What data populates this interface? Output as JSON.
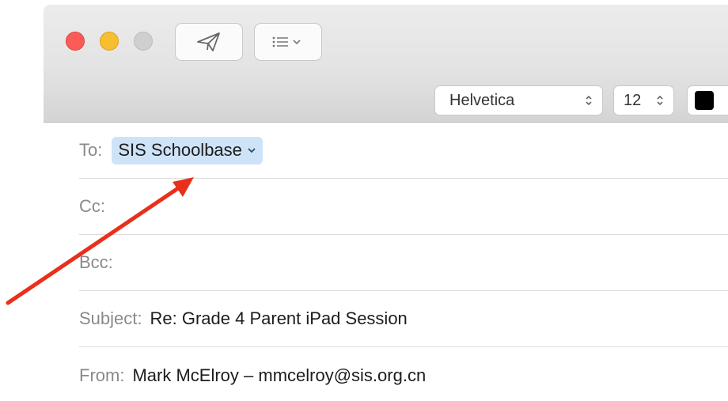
{
  "toolbar": {
    "traffic_lights": [
      "close",
      "minimize",
      "zoom"
    ],
    "send_icon": "paper-plane-icon",
    "list_icon": "list-chevron-icon",
    "font_family": "Helvetica",
    "font_size": "12",
    "text_color": "#000000"
  },
  "header": {
    "to": {
      "label": "To:",
      "recipient": "SIS Schoolbase"
    },
    "cc": {
      "label": "Cc:",
      "value": ""
    },
    "bcc": {
      "label": "Bcc:",
      "value": ""
    },
    "subject": {
      "label": "Subject:",
      "value": "Re: Grade 4 Parent iPad Session"
    },
    "from": {
      "label": "From:",
      "value": "Mark McElroy – mmcelroy@sis.org.cn"
    }
  },
  "annotation": {
    "arrow_color": "#e8301c"
  }
}
